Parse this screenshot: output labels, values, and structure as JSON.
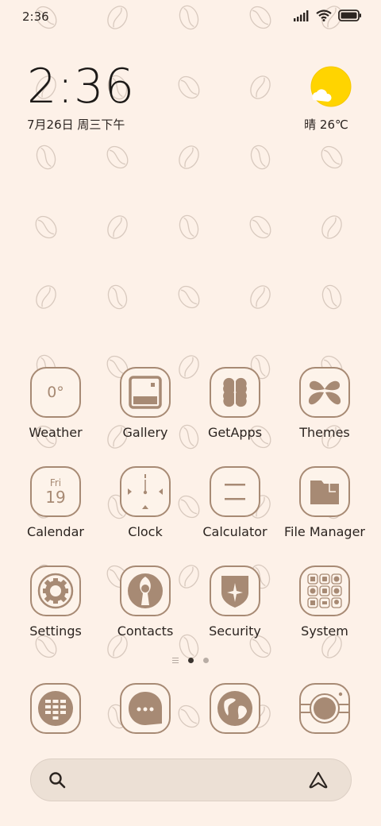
{
  "status_bar": {
    "time": "2:36",
    "icons": [
      "signal-icon",
      "wifi-icon",
      "battery-icon"
    ]
  },
  "clock_widget": {
    "time": "2:36",
    "date": "7月26日 周三下午"
  },
  "weather_widget": {
    "icon": "partly-sunny-icon",
    "text": "晴 26℃"
  },
  "apps": {
    "row1": [
      {
        "label": "Weather",
        "icon": "weather-icon",
        "glyph": "0°"
      },
      {
        "label": "Gallery",
        "icon": "gallery-icon"
      },
      {
        "label": "GetApps",
        "icon": "clover-icon"
      },
      {
        "label": "Themes",
        "icon": "bow-icon"
      }
    ],
    "row2": [
      {
        "label": "Calendar",
        "icon": "calendar-icon",
        "day_name": "Fri",
        "day_number": "19"
      },
      {
        "label": "Clock",
        "icon": "clock-icon"
      },
      {
        "label": "Calculator",
        "icon": "calculator-icon"
      },
      {
        "label": "File Manager",
        "icon": "folder-icon"
      }
    ],
    "row3": [
      {
        "label": "Settings",
        "icon": "gear-icon"
      },
      {
        "label": "Contacts",
        "icon": "contact-icon"
      },
      {
        "label": "Security",
        "icon": "shield-icon"
      },
      {
        "label": "System",
        "icon": "system-folder-icon"
      }
    ]
  },
  "dock": [
    {
      "icon": "phone-dialpad-icon"
    },
    {
      "icon": "messages-icon"
    },
    {
      "icon": "browser-globe-icon"
    },
    {
      "icon": "camera-icon"
    }
  ],
  "page_indicator": {
    "pages": 2,
    "active": 1
  },
  "search_bar": {
    "left_icon": "search-icon",
    "right_icon": "assistant-icon"
  },
  "colors": {
    "background": "#fdf1e8",
    "icon_brown": "#a78a74",
    "weather_sun": "#ffd400",
    "text": "#2b2420"
  }
}
